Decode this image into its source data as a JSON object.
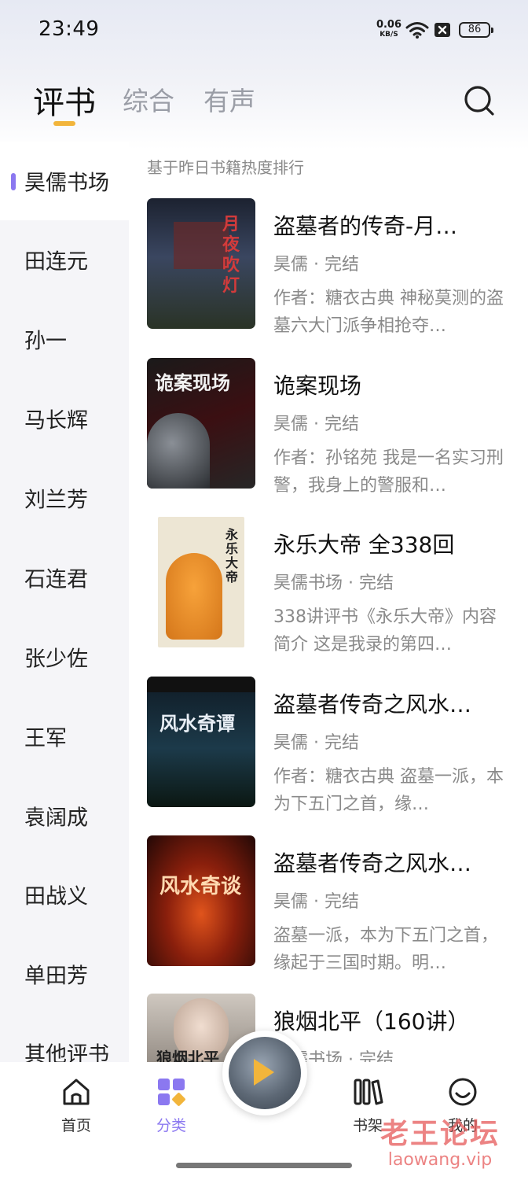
{
  "status_bar": {
    "time": "23:49",
    "net_speed_value": "0.06",
    "net_speed_unit": "KB/S",
    "battery": "86"
  },
  "header": {
    "tabs": [
      {
        "label": "评书",
        "active": true
      },
      {
        "label": "综合",
        "active": false
      },
      {
        "label": "有声",
        "active": false
      }
    ],
    "accent_color": "#f2b53b"
  },
  "sidebar": {
    "items": [
      {
        "label": "昊儒书场",
        "active": true
      },
      {
        "label": "田连元"
      },
      {
        "label": "孙一"
      },
      {
        "label": "马长辉"
      },
      {
        "label": "刘兰芳"
      },
      {
        "label": "石连君"
      },
      {
        "label": "张少佐"
      },
      {
        "label": "王军"
      },
      {
        "label": "袁阔成"
      },
      {
        "label": "田战义"
      },
      {
        "label": "单田芳"
      },
      {
        "label": "其他评书"
      }
    ],
    "active_color": "#8b78f0"
  },
  "content": {
    "subtitle": "基于昨日书籍热度排行",
    "books": [
      {
        "title": "盗墓者的传奇-月…",
        "meta": "昊儒 · 完结",
        "desc": "作者：糖衣古典 神秘莫测的盗墓六大门派争相抢夺…",
        "cover_text": "月夜吹灯"
      },
      {
        "title": "诡案现场",
        "meta": "昊儒 · 完结",
        "desc": "作者：孙铭苑 我是一名实习刑警，我身上的警服和…",
        "cover_text": "诡案现场"
      },
      {
        "title": "永乐大帝 全338回",
        "meta": "昊儒书场 · 完结",
        "desc": "338讲评书《永乐大帝》内容简介 这是我录的第四…",
        "cover_text": "永乐大帝"
      },
      {
        "title": "盗墓者传奇之风水…",
        "meta": "昊儒 · 完结",
        "desc": "作者：糖衣古典 盗墓一派，本为下五门之首，缘…",
        "cover_text": "风水奇谭"
      },
      {
        "title": "盗墓者传奇之风水…",
        "meta": "昊儒 · 完结",
        "desc": "盗墓一派，本为下五门之首，缘起于三国时期。明…",
        "cover_text": "风水奇谈"
      },
      {
        "title": "狼烟北平（160讲）",
        "meta": "昊儒书场 · 完结",
        "desc": "",
        "cover_text": "狼烟北平"
      }
    ]
  },
  "bottom_nav": {
    "items": [
      {
        "label": "首页",
        "icon": "home-icon"
      },
      {
        "label": "分类",
        "icon": "category-icon",
        "active": true
      },
      {
        "label": "书架",
        "icon": "bookshelf-icon"
      },
      {
        "label": "我的",
        "icon": "profile-icon"
      }
    ],
    "player_icon": "play-icon"
  },
  "watermark": {
    "line1": "老王论坛",
    "line2": "laowang.vip"
  }
}
